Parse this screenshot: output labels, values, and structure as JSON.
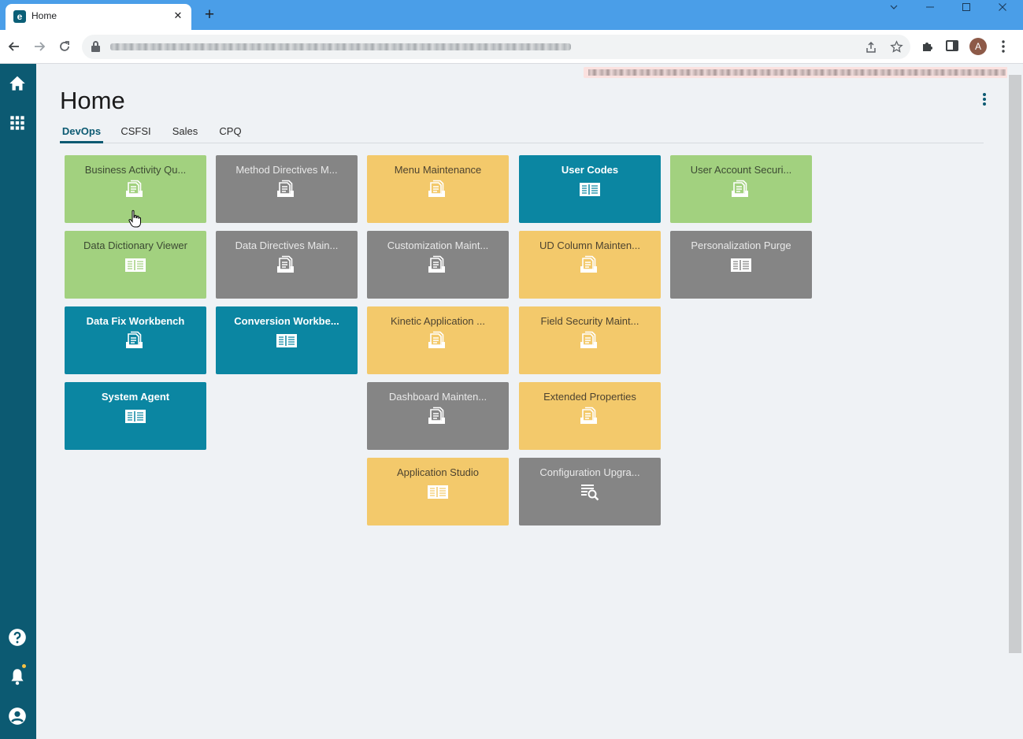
{
  "browser": {
    "tab_title": "Home",
    "tab_favicon_letter": "e",
    "close_glyph": "✕",
    "new_tab_glyph": "+",
    "profile_initial": "A"
  },
  "app": {
    "page_title": "Home",
    "tabs": [
      {
        "label": "DevOps",
        "active": true
      },
      {
        "label": "CSFSI",
        "active": false
      },
      {
        "label": "Sales",
        "active": false
      },
      {
        "label": "CPQ",
        "active": false
      }
    ],
    "tiles": [
      {
        "label": "Business Activity Qu...",
        "color": "green",
        "icon": "documents-icon"
      },
      {
        "label": "Method Directives M...",
        "color": "gray",
        "icon": "documents-icon"
      },
      {
        "label": "Menu Maintenance",
        "color": "yellow",
        "icon": "documents-icon"
      },
      {
        "label": "User Codes",
        "color": "teal",
        "icon": "book-icon"
      },
      {
        "label": "User Account Securi...",
        "color": "green",
        "icon": "documents-icon"
      },
      {
        "label": "Data Dictionary Viewer",
        "color": "green",
        "icon": "book-icon"
      },
      {
        "label": "Data Directives Main...",
        "color": "gray",
        "icon": "documents-icon"
      },
      {
        "label": "Customization Maint...",
        "color": "gray",
        "icon": "documents-icon"
      },
      {
        "label": "UD Column Mainten...",
        "color": "yellow",
        "icon": "documents-icon"
      },
      {
        "label": "Personalization Purge",
        "color": "gray",
        "icon": "book-icon"
      },
      {
        "label": "Data Fix Workbench",
        "color": "teal",
        "icon": "documents-icon"
      },
      {
        "label": "Conversion Workbe...",
        "color": "teal",
        "icon": "book-icon"
      },
      {
        "label": "Kinetic Application ...",
        "color": "yellow",
        "icon": "documents-icon"
      },
      {
        "label": "Field Security Maint...",
        "color": "yellow",
        "icon": "documents-icon"
      },
      {
        "label": "System Agent",
        "color": "teal",
        "icon": "book-icon"
      },
      {
        "label": "Dashboard Mainten...",
        "color": "gray",
        "icon": "documents-icon"
      },
      {
        "label": "Extended Properties",
        "color": "yellow",
        "icon": "documents-icon"
      },
      {
        "label": "Application Studio",
        "color": "yellow",
        "icon": "book-icon"
      },
      {
        "label": "Configuration Upgra...",
        "color": "gray",
        "icon": "list-search-icon"
      }
    ]
  },
  "colors": {
    "sidebar": "#0c5a72",
    "accent": "#0c5a72",
    "tile_green": "#a2d17f",
    "tile_gray": "#858585",
    "tile_yellow": "#f3c96b",
    "tile_teal": "#0b86a2",
    "browser_frame": "#4a9ee8",
    "notification_dot": "#f6c244"
  }
}
